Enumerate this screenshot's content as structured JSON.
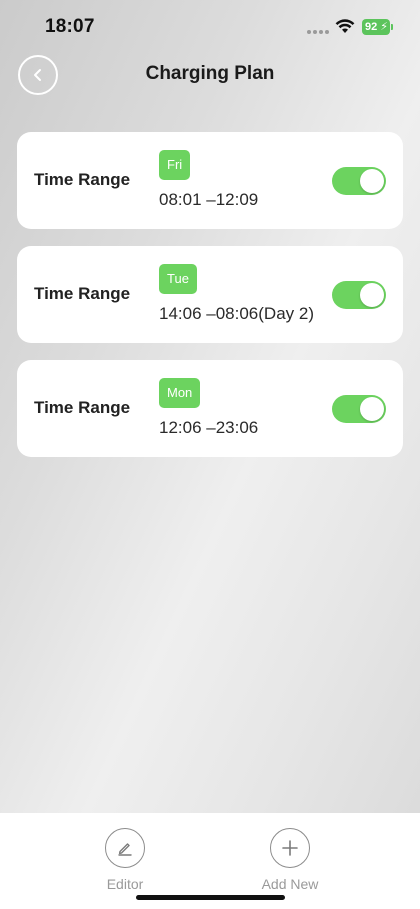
{
  "status_bar": {
    "time": "18:07",
    "battery": "92"
  },
  "header": {
    "title": "Charging Plan"
  },
  "plans": [
    {
      "label": "Time Range",
      "day": "Fri",
      "time": "08:01 –12:09",
      "enabled": true
    },
    {
      "label": "Time Range",
      "day": "Tue",
      "time": "14:06 –08:06(Day 2)",
      "enabled": true
    },
    {
      "label": "Time Range",
      "day": "Mon",
      "time": "12:06 –23:06",
      "enabled": true
    }
  ],
  "bottom_bar": {
    "editor_label": "Editor",
    "add_new_label": "Add New"
  },
  "colors": {
    "accent": "#6cd35f",
    "battery": "#5cc45c"
  },
  "icons": {
    "back": "chevron-left-icon",
    "editor": "pencil-icon",
    "add_new": "plus-icon",
    "wifi": "wifi-icon"
  }
}
